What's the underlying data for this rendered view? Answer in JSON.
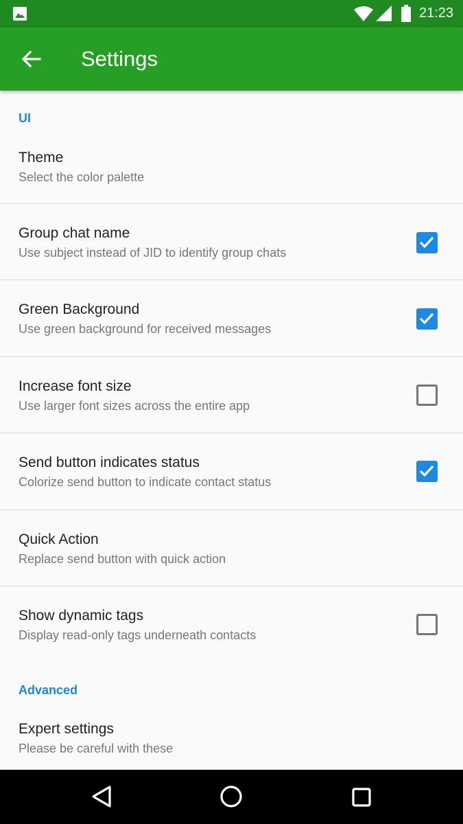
{
  "status_bar": {
    "time": "21:23"
  },
  "app_bar": {
    "title": "Settings"
  },
  "sections": [
    {
      "title": "UI"
    },
    {
      "title": "Advanced"
    }
  ],
  "prefs": [
    {
      "title": "Theme",
      "summary": "Select the color palette"
    },
    {
      "title": "Group chat name",
      "summary": "Use subject instead of JID to identify group chats",
      "checked": true
    },
    {
      "title": "Green Background",
      "summary": "Use green background for received messages",
      "checked": true
    },
    {
      "title": "Increase font size",
      "summary": "Use larger font sizes across the entire app",
      "checked": false
    },
    {
      "title": "Send button indicates status",
      "summary": "Colorize send button to indicate contact status",
      "checked": true
    },
    {
      "title": "Quick Action",
      "summary": "Replace send button with quick action"
    },
    {
      "title": "Show dynamic tags",
      "summary": "Display read-only tags underneath contacts",
      "checked": false
    },
    {
      "title": "Expert settings",
      "summary": "Please be careful with these"
    }
  ],
  "colors": {
    "status_bar": "#1f8a1f",
    "app_bar": "#279f27",
    "accent": "#1e88e5"
  }
}
